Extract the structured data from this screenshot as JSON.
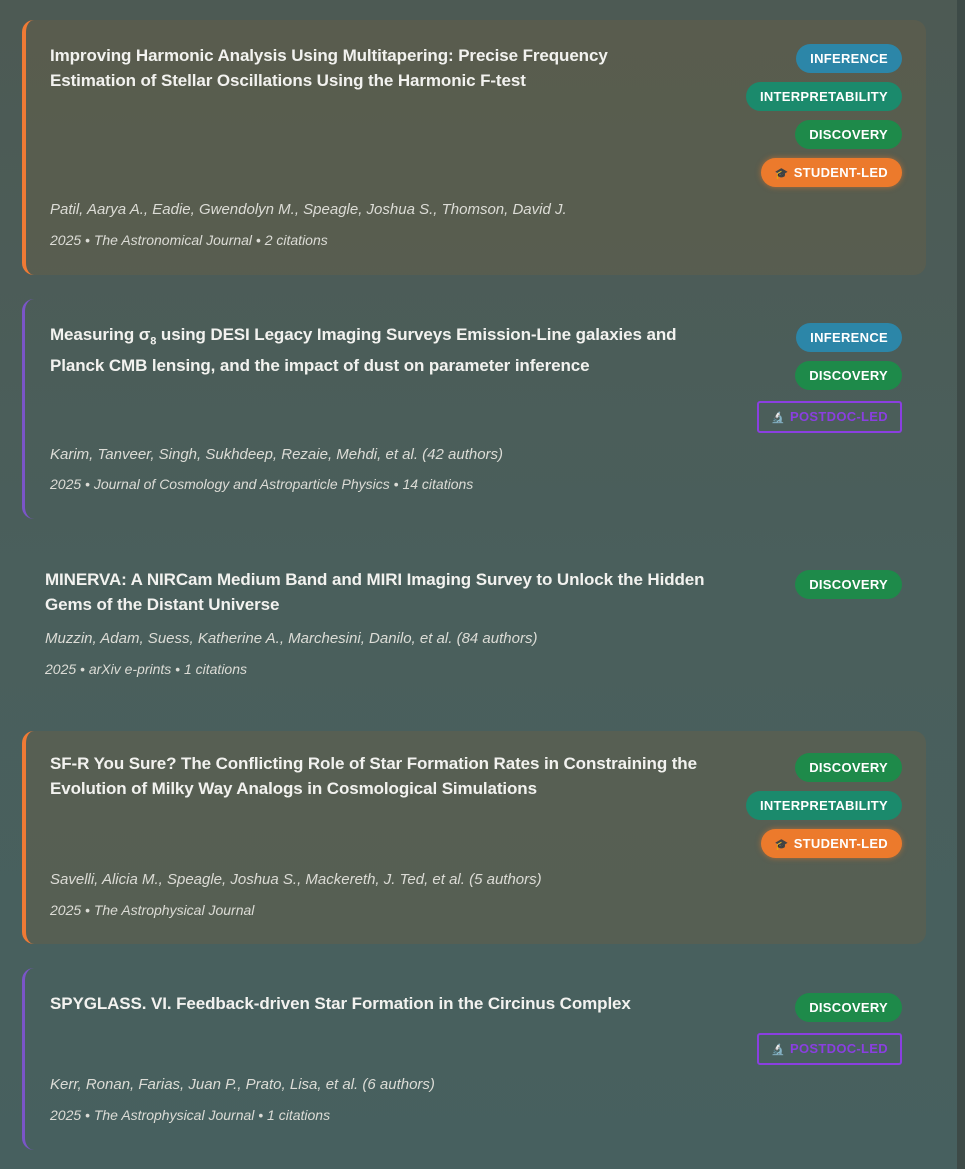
{
  "papers": [
    {
      "title": "Improving Harmonic Analysis Using Multitapering: Precise Frequency Estimation of Stellar Oscillations Using the Harmonic F-test",
      "authors": "Patil, Aarya A., Eadie, Gwendolyn M., Speagle, Joshua S., Thomson, David J.",
      "meta": "2025 • The Astronomical Journal • 2 citations",
      "tags": {
        "inference": "INFERENCE",
        "interpretability": "INTERPRETABILITY",
        "discovery": "DISCOVERY",
        "student": "STUDENT-LED"
      }
    },
    {
      "title_prefix": "Measuring σ",
      "title_subscript": "8",
      "title_rest": " using DESI Legacy Imaging Surveys Emission-Line galaxies and Planck CMB lensing, and the impact of dust on parameter inference",
      "authors": "Karim, Tanveer, Singh, Sukhdeep, Rezaie, Mehdi, et al. (42 authors)",
      "meta": "2025 • Journal of Cosmology and Astroparticle Physics • 14 citations",
      "tags": {
        "inference": "INFERENCE",
        "discovery": "DISCOVERY",
        "postdoc": "POSTDOC-LED"
      }
    },
    {
      "title": "MINERVA: A NIRCam Medium Band and MIRI Imaging Survey to Unlock the Hidden Gems of the Distant Universe",
      "authors": "Muzzin, Adam, Suess, Katherine A., Marchesini, Danilo, et al. (84 authors)",
      "meta": "2025 • arXiv e-prints • 1 citations",
      "tags": {
        "discovery": "DISCOVERY"
      }
    },
    {
      "title": "SF-R You Sure? The Conflicting Role of Star Formation Rates in Constraining the Evolution of Milky Way Analogs in Cosmological Simulations",
      "authors": "Savelli, Alicia M., Speagle, Joshua S., Mackereth, J. Ted, et al. (5 authors)",
      "meta": "2025 • The Astrophysical Journal",
      "tags": {
        "discovery": "DISCOVERY",
        "interpretability": "INTERPRETABILITY",
        "student": "STUDENT-LED"
      }
    },
    {
      "title": "SPYGLASS. VI. Feedback-driven Star Formation in the Circinus Complex",
      "authors": "Kerr, Ronan, Farias, Juan P., Prato, Lisa, et al. (6 authors)",
      "meta": "2025 • The Astrophysical Journal • 1 citations",
      "tags": {
        "discovery": "DISCOVERY",
        "postdoc": "POSTDOC-LED"
      }
    }
  ],
  "icons": {
    "student": "graduation-cap-icon",
    "postdoc": "microscope-icon"
  },
  "colors": {
    "student_accent": "#ef7a35",
    "postdoc_accent": "#8a3fe0",
    "inference": "#2c86a8",
    "interpretability": "#1b8a6c",
    "discovery": "#1e8a4a"
  }
}
